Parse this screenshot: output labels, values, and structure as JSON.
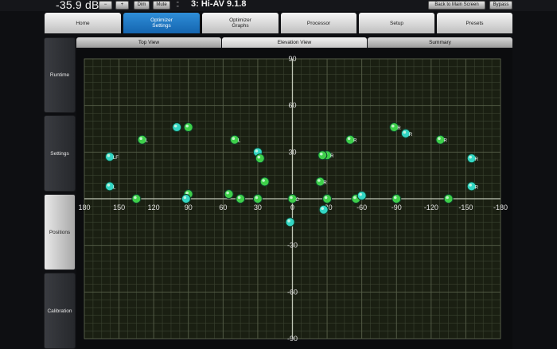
{
  "topbar": {
    "volume": "-35.9 dB",
    "minus_label": "−",
    "plus_label": "+",
    "dim_label": "Dim",
    "mute_label": "Mute",
    "preset_name": "3: Hi-AV 9.1.8",
    "back_label": "Back to Main Screen",
    "bypass_label": "Bypass"
  },
  "main_tabs": [
    {
      "label": "Home"
    },
    {
      "label": "Optimizer\nSettings"
    },
    {
      "label": "Optimizer\nGraphs"
    },
    {
      "label": "Processor"
    },
    {
      "label": "Setup"
    },
    {
      "label": "Presets"
    }
  ],
  "side_tabs": [
    {
      "label": "Runtime"
    },
    {
      "label": "Settings"
    },
    {
      "label": "Positions"
    },
    {
      "label": "Calibration"
    }
  ],
  "sub_tabs": [
    {
      "label": "Top View"
    },
    {
      "label": "Elevation View"
    },
    {
      "label": "Summary"
    }
  ],
  "accent_color": "#1f7bc9",
  "chart_data": {
    "type": "scatter",
    "x_ticks": [
      "180",
      "150",
      "120",
      "90",
      "60",
      "30",
      "0",
      "-30",
      "-60",
      "-90",
      "-120",
      "-150",
      "-180"
    ],
    "y_ticks": [
      "90",
      "60",
      "30",
      "0",
      "-30",
      "-60",
      "-90"
    ],
    "xlim": [
      180,
      -180
    ],
    "ylim": [
      -90,
      90
    ],
    "grid": true,
    "points": [
      {
        "x": 0,
        "y": 0,
        "label": "C",
        "color": "green"
      },
      {
        "x": 2,
        "y": -15,
        "label": "",
        "color": "cyan"
      },
      {
        "x": 30,
        "y": 0,
        "label": "",
        "color": "green"
      },
      {
        "x": -30,
        "y": 0,
        "label": "",
        "color": "green"
      },
      {
        "x": -27,
        "y": -7,
        "label": "",
        "color": "cyan"
      },
      {
        "x": 45,
        "y": 0,
        "label": "",
        "color": "green"
      },
      {
        "x": -55,
        "y": 0,
        "label": "",
        "color": "green"
      },
      {
        "x": 55,
        "y": 3,
        "label": "",
        "color": "green"
      },
      {
        "x": -60,
        "y": 2,
        "label": "",
        "color": "cyan"
      },
      {
        "x": 90,
        "y": 3,
        "label": "",
        "color": "green"
      },
      {
        "x": -90,
        "y": 0,
        "label": "",
        "color": "green"
      },
      {
        "x": 92,
        "y": 0,
        "label": "",
        "color": "cyan"
      },
      {
        "x": 135,
        "y": 0,
        "label": "",
        "color": "green"
      },
      {
        "x": -135,
        "y": 0,
        "label": "",
        "color": "green"
      },
      {
        "x": 158,
        "y": 8,
        "label": "L",
        "color": "cyan"
      },
      {
        "x": -155,
        "y": 8,
        "label": "R",
        "color": "cyan"
      },
      {
        "x": 158,
        "y": 27,
        "label": "LF",
        "color": "cyan"
      },
      {
        "x": -155,
        "y": 26,
        "label": "R",
        "color": "cyan"
      },
      {
        "x": 130,
        "y": 38,
        "label": "L",
        "color": "green"
      },
      {
        "x": -128,
        "y": 38,
        "label": "R",
        "color": "green"
      },
      {
        "x": 100,
        "y": 46,
        "label": "",
        "color": "cyan"
      },
      {
        "x": 90,
        "y": 46,
        "label": "",
        "color": "green"
      },
      {
        "x": -88,
        "y": 46,
        "label": "R",
        "color": "green"
      },
      {
        "x": -98,
        "y": 42,
        "label": "R",
        "color": "cyan"
      },
      {
        "x": 50,
        "y": 38,
        "label": "L",
        "color": "green"
      },
      {
        "x": -50,
        "y": 38,
        "label": "R",
        "color": "green"
      },
      {
        "x": 30,
        "y": 30,
        "label": "",
        "color": "cyan"
      },
      {
        "x": 28,
        "y": 26,
        "label": "",
        "color": "green"
      },
      {
        "x": -30,
        "y": 28,
        "label": "R",
        "color": "green"
      },
      {
        "x": -26,
        "y": 28,
        "label": "",
        "color": "green"
      },
      {
        "x": 24,
        "y": 11,
        "label": "",
        "color": "green"
      },
      {
        "x": -24,
        "y": 11,
        "label": "R",
        "color": "green"
      }
    ]
  }
}
